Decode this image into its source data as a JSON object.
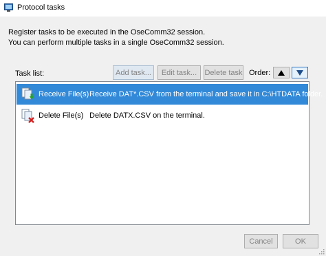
{
  "window": {
    "title": "Protocol tasks"
  },
  "intro": {
    "line1": "Register tasks to be executed in the OseComm32 session.",
    "line2": "You can perform multiple tasks in a single OseComm32 session."
  },
  "task_list": {
    "label": "Task list:",
    "add_label": "Add task...",
    "edit_label": "Edit task...",
    "delete_label": "Delete task",
    "order_label": "Order:",
    "items": [
      {
        "name": "Receive File(s)",
        "description": "Receive DAT*.CSV from the terminal and save it in C:\\HTDATA folder.",
        "icon": "receive-file-icon",
        "selected": true
      },
      {
        "name": "Delete File(s)",
        "description": "Delete DATX.CSV on the terminal.",
        "icon": "delete-file-icon",
        "selected": false
      }
    ]
  },
  "footer": {
    "cancel_label": "Cancel",
    "ok_label": "OK"
  },
  "colors": {
    "selection": "#3289d8",
    "background": "#f0f0f0"
  }
}
